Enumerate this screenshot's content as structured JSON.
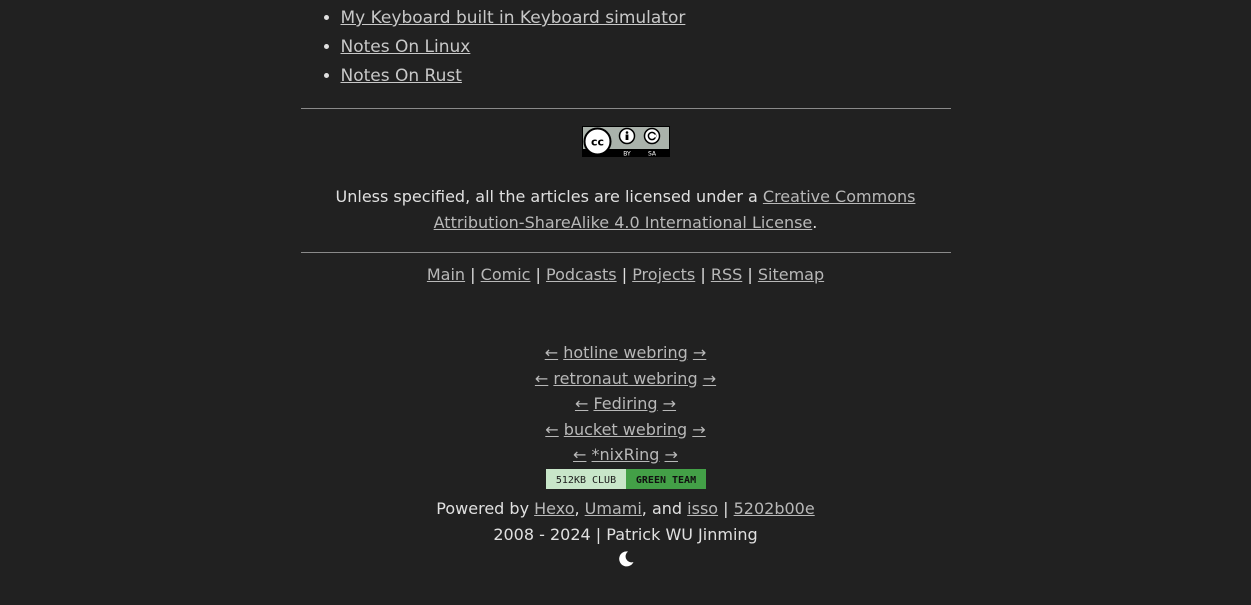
{
  "recent_posts": [
    {
      "label": "My Keyboard built in Keyboard simulator"
    },
    {
      "label": "Notes On Linux"
    },
    {
      "label": "Notes On Rust"
    }
  ],
  "license": {
    "badge_icon": "cc-by-sa-icon",
    "badge_text_by": "BY",
    "badge_text_sa": "SA",
    "prefix": "Unless specified, all the articles are licensed under a ",
    "link_text": "Creative Commons Attribution-ShareAlike 4.0 International License",
    "suffix": "."
  },
  "nav": {
    "items": [
      {
        "label": "Main"
      },
      {
        "label": "Comic"
      },
      {
        "label": "Podcasts"
      },
      {
        "label": "Projects"
      },
      {
        "label": "RSS"
      },
      {
        "label": "Sitemap"
      }
    ],
    "separator": "|"
  },
  "webrings": [
    {
      "prev": "←",
      "name": "hotline webring",
      "next": "→"
    },
    {
      "prev": "←",
      "name": "retronaut webring",
      "next": "→"
    },
    {
      "prev": "←",
      "name": "Fediring",
      "next": "→"
    },
    {
      "prev": "←",
      "name": "bucket webring",
      "next": "→"
    },
    {
      "prev": "←",
      "name": "*nixRing",
      "next": "→"
    }
  ],
  "club_badge": {
    "left": "512KB CLUB",
    "right": "GREEN TEAM",
    "left_color": "#c8e6c9",
    "right_color": "#43a047"
  },
  "powered": {
    "prefix": "Powered by ",
    "hexo": "Hexo",
    "comma": ", ",
    "umami": "Umami",
    "and": ", and ",
    "isso": "isso",
    "sep": " | ",
    "commit": "5202b00e"
  },
  "copyright": "2008 - 2024 | Patrick WU Jinming",
  "theme_toggle_icon": "moon-icon",
  "colors": {
    "background": "#212121",
    "text": "#e0e0e0",
    "link": "#b8b8b8"
  }
}
